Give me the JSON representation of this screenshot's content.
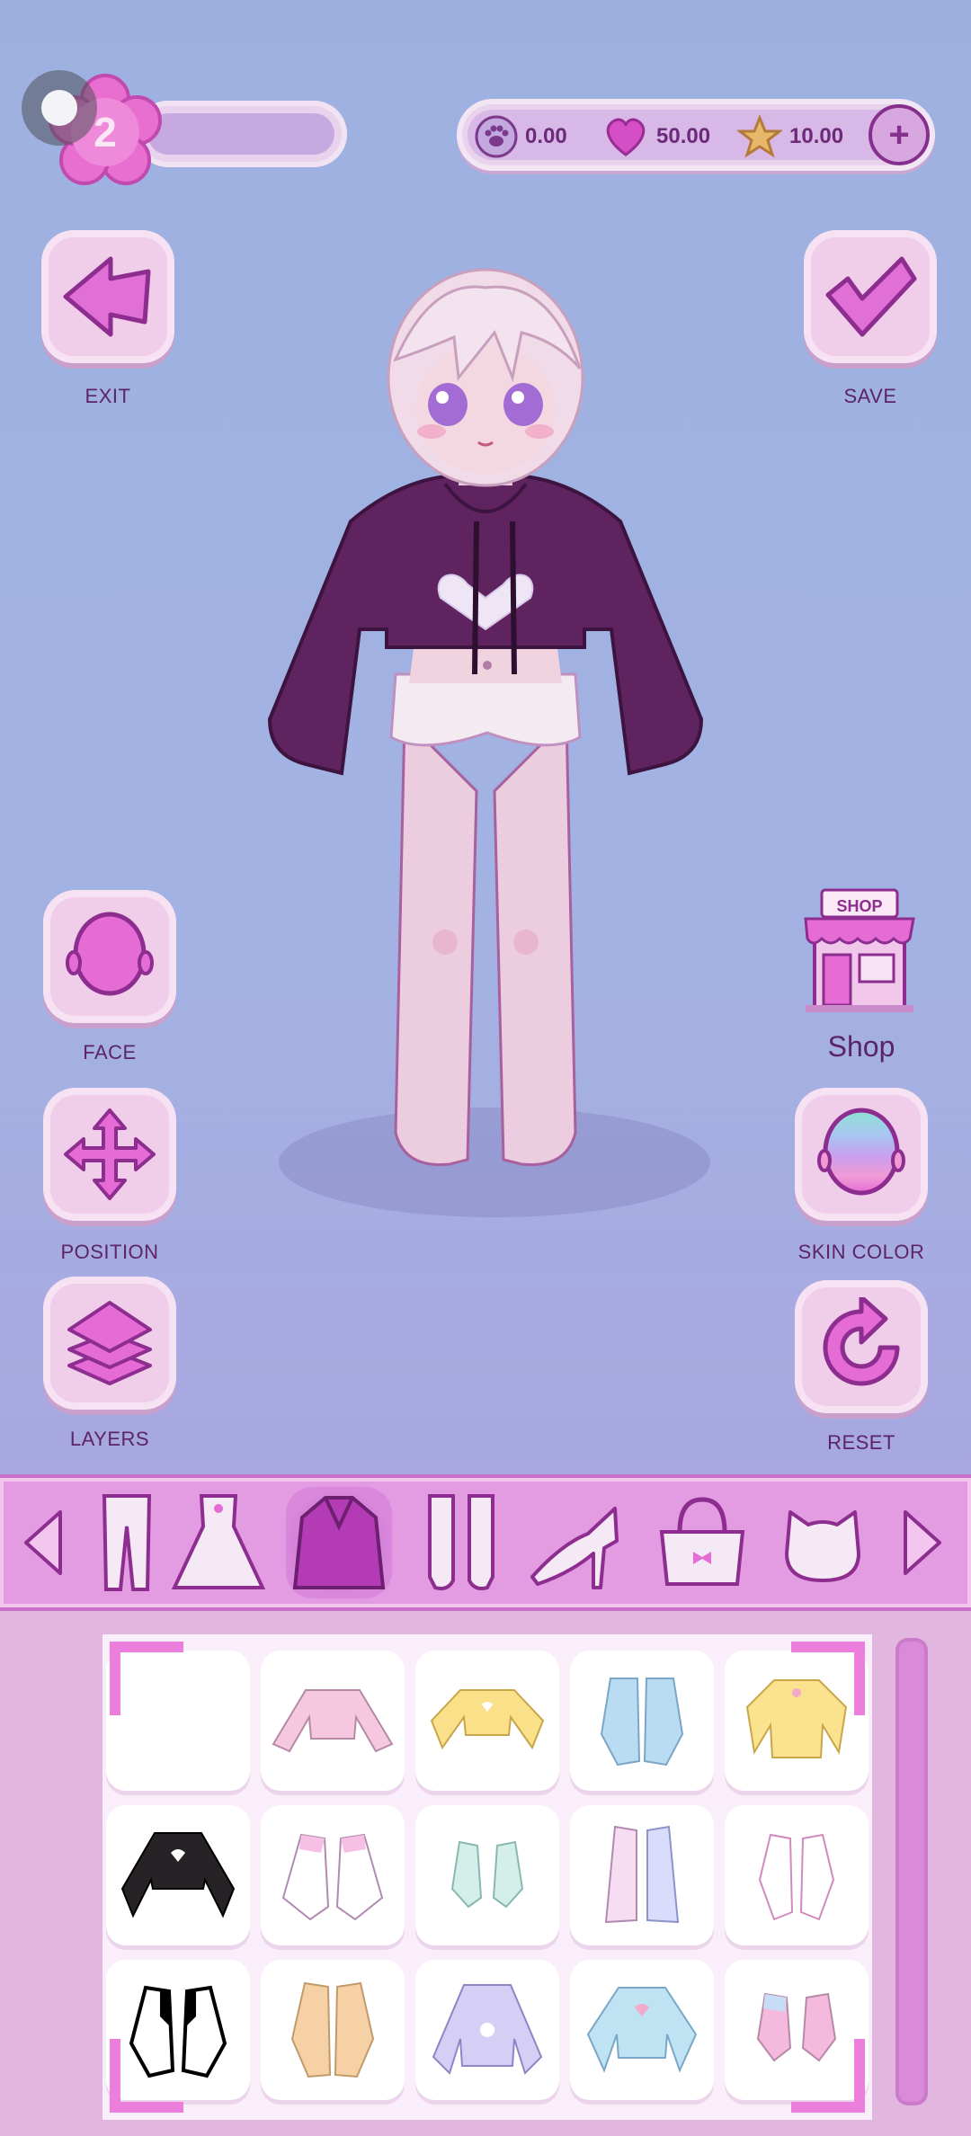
{
  "player": {
    "level": "2"
  },
  "currency": {
    "paw": "0.00",
    "hearts": "50.00",
    "stars": "10.00",
    "add_label": "+"
  },
  "actions": {
    "exit": "EXIT",
    "save": "SAVE",
    "face": "FACE",
    "position": "POSITION",
    "layers": "LAYERS",
    "shop_sign": "SHOP",
    "shop": "Shop",
    "skin_color": "SKIN COLOR",
    "reset": "RESET"
  },
  "categories": [
    "pants",
    "dress",
    "jacket",
    "socks",
    "shoes",
    "bag",
    "hat"
  ],
  "selected_category": "jacket",
  "items": [
    "empty",
    "pink-crop-top",
    "yellow-heart-crop-top",
    "blue-jacket",
    "yellow-sweater",
    "black-hoodie",
    "white-pink-sleeves",
    "mint-sleeves",
    "pastel-stripe-cardigan",
    "pink-sleeve-cardigan",
    "black-white-jacket",
    "tan-jacket",
    "lavender-hoodie",
    "blue-heart-top",
    "pink-blue-sleeves"
  ],
  "colors": {
    "accent": "#c44fc6",
    "dark": "#86308e",
    "bar": "#e39be1"
  }
}
